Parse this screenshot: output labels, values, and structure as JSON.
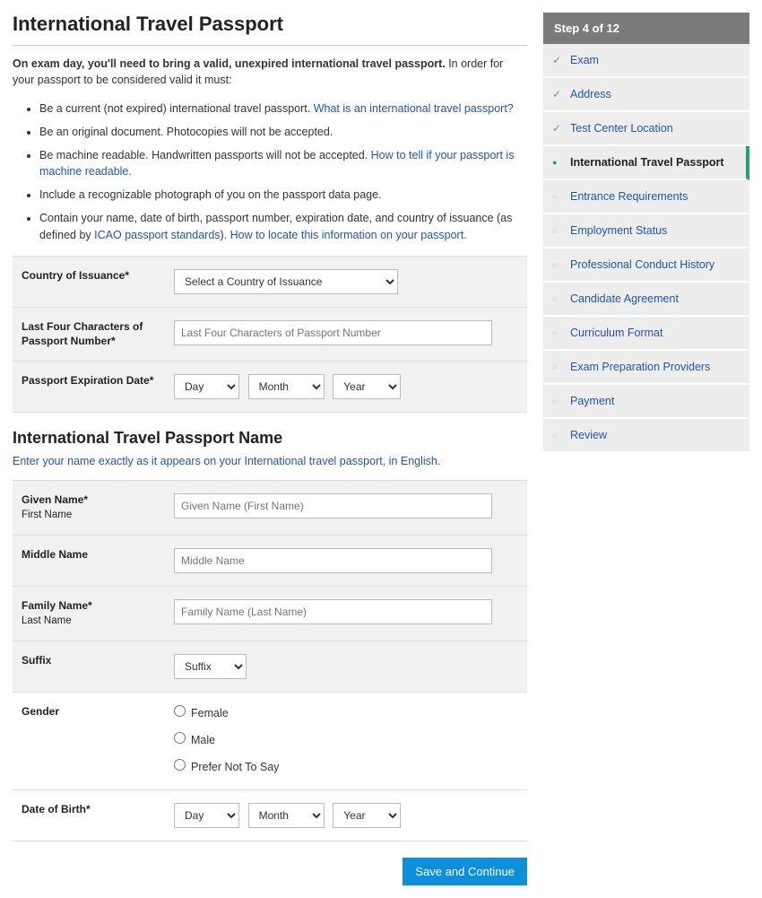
{
  "page": {
    "title": "International Travel Passport",
    "intro_bold": "On exam day, you'll need to bring a valid, unexpired international travel passport.",
    "intro_rest": " In order for your passport to be considered valid it must:",
    "requirements": [
      {
        "text": "Be a current (not expired) international travel passport. ",
        "link": "What is an international travel passport?"
      },
      {
        "text": "Be an original document. Photocopies will not be accepted.",
        "link": ""
      },
      {
        "text": "Be machine readable. Handwritten passports will not be accepted. ",
        "link": "How to tell if your passport is machine readable."
      },
      {
        "text": "Include a recognizable photograph of you on the passport data page.",
        "link": ""
      },
      {
        "text": "Contain your name, date of birth, passport number, expiration date, and country of issuance (as defined by ",
        "link": "ICAO passport standards",
        "text2": "). ",
        "link2": "How to locate this information on your passport."
      }
    ],
    "section2_title": "International Travel Passport Name",
    "section2_sub": "Enter your name exactly as it appears on your International travel passport, in English."
  },
  "fields": {
    "country": {
      "label": "Country of Issuance*",
      "placeholder": "Select a Country of Issuance"
    },
    "last4": {
      "label": "Last Four Characters of Passport Number*",
      "placeholder": "Last Four Characters of Passport Number"
    },
    "exp": {
      "label": "Passport Expiration Date*",
      "day": "Day",
      "month": "Month",
      "year": "Year"
    },
    "given": {
      "label": "Given Name*",
      "sub": "First Name",
      "placeholder": "Given Name (First Name)"
    },
    "middle": {
      "label": "Middle Name",
      "placeholder": "Middle Name"
    },
    "family": {
      "label": "Family Name*",
      "sub": "Last Name",
      "placeholder": "Family Name (Last Name)"
    },
    "suffix": {
      "label": "Suffix",
      "placeholder": "Suffix"
    },
    "gender": {
      "label": "Gender",
      "opts": {
        "f": "Female",
        "m": "Male",
        "p": "Prefer Not To Say"
      }
    },
    "dob": {
      "label": "Date of Birth*",
      "day": "Day",
      "month": "Month",
      "year": "Year"
    }
  },
  "actions": {
    "submit": "Save and Continue"
  },
  "sidebar": {
    "header": "Step 4 of 12",
    "steps": [
      {
        "label": "Exam",
        "state": "done"
      },
      {
        "label": "Address",
        "state": "done"
      },
      {
        "label": "Test Center Location",
        "state": "done"
      },
      {
        "label": "International Travel Passport",
        "state": "active"
      },
      {
        "label": "Entrance Requirements",
        "state": "pending"
      },
      {
        "label": "Employment Status",
        "state": "pending"
      },
      {
        "label": "Professional Conduct History",
        "state": "pending"
      },
      {
        "label": "Candidate Agreement",
        "state": "pending"
      },
      {
        "label": "Curriculum Format",
        "state": "pending"
      },
      {
        "label": "Exam Preparation Providers",
        "state": "pending"
      },
      {
        "label": "Payment",
        "state": "pending"
      },
      {
        "label": "Review",
        "state": "pending"
      }
    ]
  }
}
